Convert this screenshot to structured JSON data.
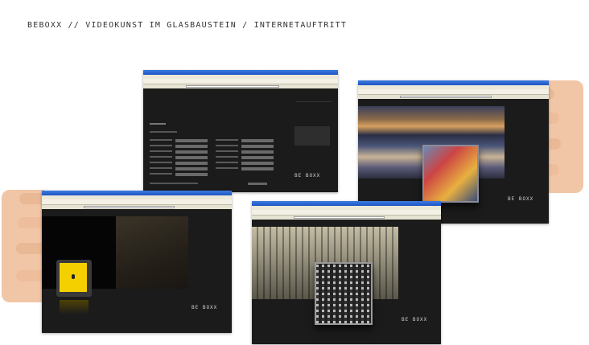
{
  "page": {
    "title": "BEBOXX // VIDEOKUNST IM GLASBAUSTEIN / INTERNETAUFTRITT"
  },
  "screens": [
    {
      "name": "form-page",
      "logo": "BE BOXX"
    },
    {
      "name": "city-page",
      "logo": "BE BOXX"
    },
    {
      "name": "yellow-box-page",
      "logo": "BE BOXX"
    },
    {
      "name": "glass-block-page",
      "logo": "BE BOXX"
    }
  ],
  "colors": {
    "page_bg": "#ffffff",
    "site_bg": "#1b1b1b",
    "xp_titlebar": "#2a64cf",
    "xp_chrome": "#ece9d8",
    "accent_yellow": "#f4d000",
    "skin": "#f1c6a6"
  }
}
